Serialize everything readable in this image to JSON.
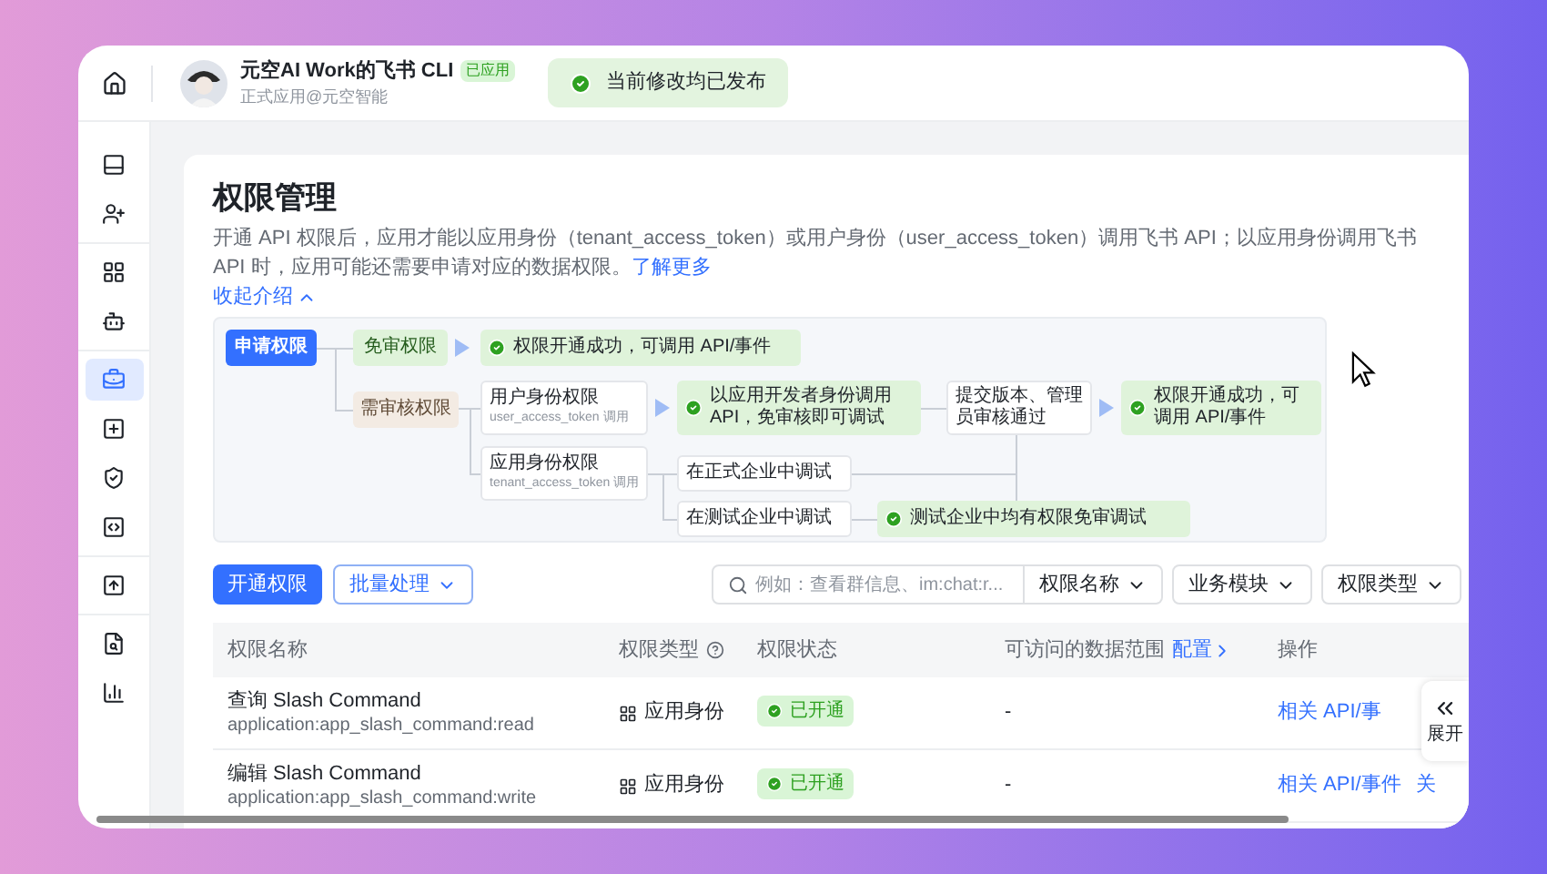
{
  "app": {
    "name": "元空AI Work的飞书 CLI",
    "badge": "已应用",
    "subtitle": "正式应用@元空智能"
  },
  "toast": {
    "text": "当前修改均已发布"
  },
  "sidebar": {
    "groups": [
      {
        "items": [
          {
            "selected": false
          },
          {
            "selected": false
          }
        ]
      },
      {
        "items": [
          {
            "selected": false
          },
          {
            "selected": false
          }
        ]
      },
      {
        "items": [
          {
            "selected": true
          },
          {
            "selected": false
          },
          {
            "selected": false
          },
          {
            "selected": false
          }
        ]
      },
      {
        "items": [
          {
            "selected": false
          }
        ]
      },
      {
        "items": [
          {
            "selected": false
          },
          {
            "selected": false
          }
        ]
      }
    ]
  },
  "page": {
    "title": "权限管理",
    "description": "开通 API 权限后，应用才能以应用身份（tenant_access_token）或用户身份（user_access_token）调用飞书 API；以应用身份调用飞书 API 时，应用可能还需要申请对应的数据权限。",
    "learn_more": "了解更多",
    "collapse": "收起介绍"
  },
  "flow": {
    "nodes": [
      {
        "kind": "start",
        "text": "申请权限"
      },
      {
        "kind": "free",
        "text": "免审权限"
      },
      {
        "kind": "success",
        "text": "权限开通成功，可调用 API/事件"
      },
      {
        "kind": "review",
        "text": "需审核权限"
      },
      {
        "kind": "step",
        "text": "用户身份权限",
        "note": "user_access_token 调用"
      },
      {
        "kind": "success",
        "text": "以应用开发者身份调用 API，免审核即可调试"
      },
      {
        "kind": "step",
        "text": "提交版本、管理员审核通过"
      },
      {
        "kind": "success",
        "text": "权限开通成功，可调用 API/事件"
      },
      {
        "kind": "step",
        "text": "应用身份权限",
        "note": "tenant_access_token 调用"
      },
      {
        "kind": "step",
        "text": "在正式企业中调试"
      },
      {
        "kind": "step",
        "text": "在测试企业中调试"
      },
      {
        "kind": "success",
        "text": "测试企业中均有权限免审调试"
      }
    ]
  },
  "toolbar": {
    "primary": "开通权限",
    "batch": "批量处理",
    "search_placeholder": "例如：查看群信息、im:chat:r...",
    "search_scope": "权限名称",
    "filters": [
      "业务模块",
      "权限类型"
    ]
  },
  "table": {
    "columns": [
      {
        "label": "权限名称"
      },
      {
        "label": "权限类型",
        "help": true
      },
      {
        "label": "权限状态"
      },
      {
        "label": "可访问的数据范围",
        "link": "配置"
      },
      {
        "label": "操作"
      }
    ],
    "rows": [
      {
        "name": "查询 Slash Command",
        "scope": "application:app_slash_command:read",
        "type": "应用身份",
        "status": "已开通",
        "range": "-",
        "actions": [
          "相关 API/事"
        ]
      },
      {
        "name": "编辑 Slash Command",
        "scope": "application:app_slash_command:write",
        "type": "应用身份",
        "status": "已开通",
        "range": "-",
        "actions": [
          "相关 API/事件",
          "关"
        ]
      }
    ]
  },
  "side_panel": {
    "label": "展开"
  }
}
